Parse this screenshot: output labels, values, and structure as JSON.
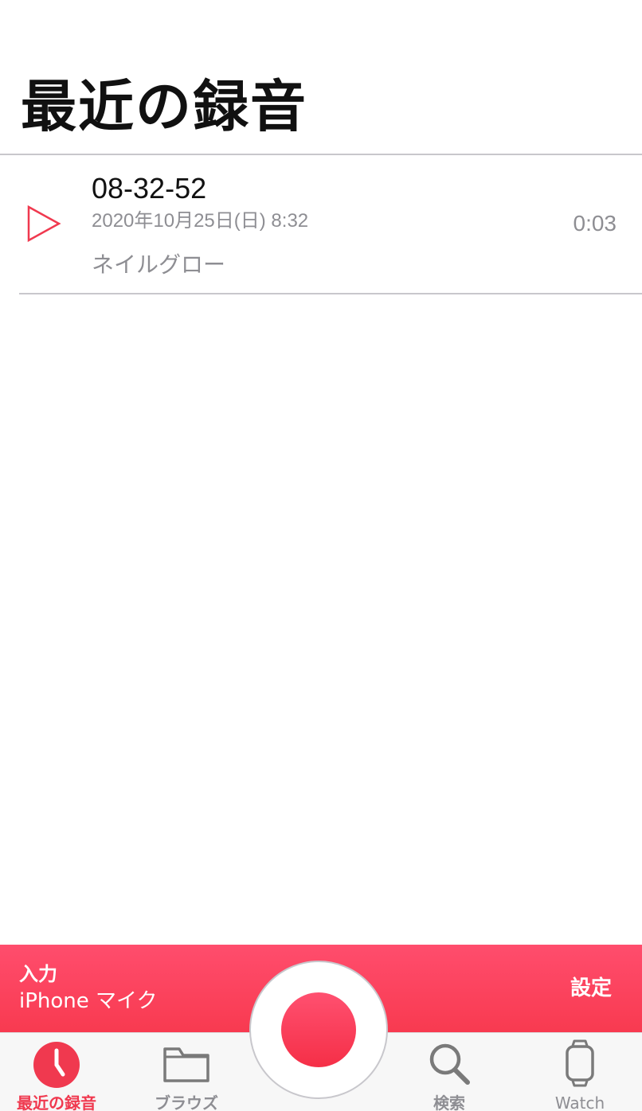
{
  "header": {
    "title": "最近の録音"
  },
  "recordings": [
    {
      "name": "08-32-52",
      "date": "2020年10月25日(日) 8:32",
      "duration": "0:03",
      "location": "ネイルグロー",
      "play_icon": "play-triangle-outline"
    }
  ],
  "input_bar": {
    "label": "入力",
    "device": "iPhone マイク",
    "settings_label": "設定",
    "background_color": "#f83a50"
  },
  "record_button": {
    "icon": "record-circle"
  },
  "tabs": [
    {
      "label": "最近の録音",
      "icon": "clock-icon",
      "active": true
    },
    {
      "label": "ブラウズ",
      "icon": "folder-icon",
      "active": false
    },
    {
      "label": "検索",
      "icon": "search-icon",
      "active": false
    },
    {
      "label": "Watch",
      "icon": "watch-icon",
      "active": false
    }
  ],
  "colors": {
    "accent": "#f0394f",
    "secondary_text": "#8e8e93",
    "divider": "#c8c7cc",
    "inactive_icon": "#7a7a7a"
  }
}
